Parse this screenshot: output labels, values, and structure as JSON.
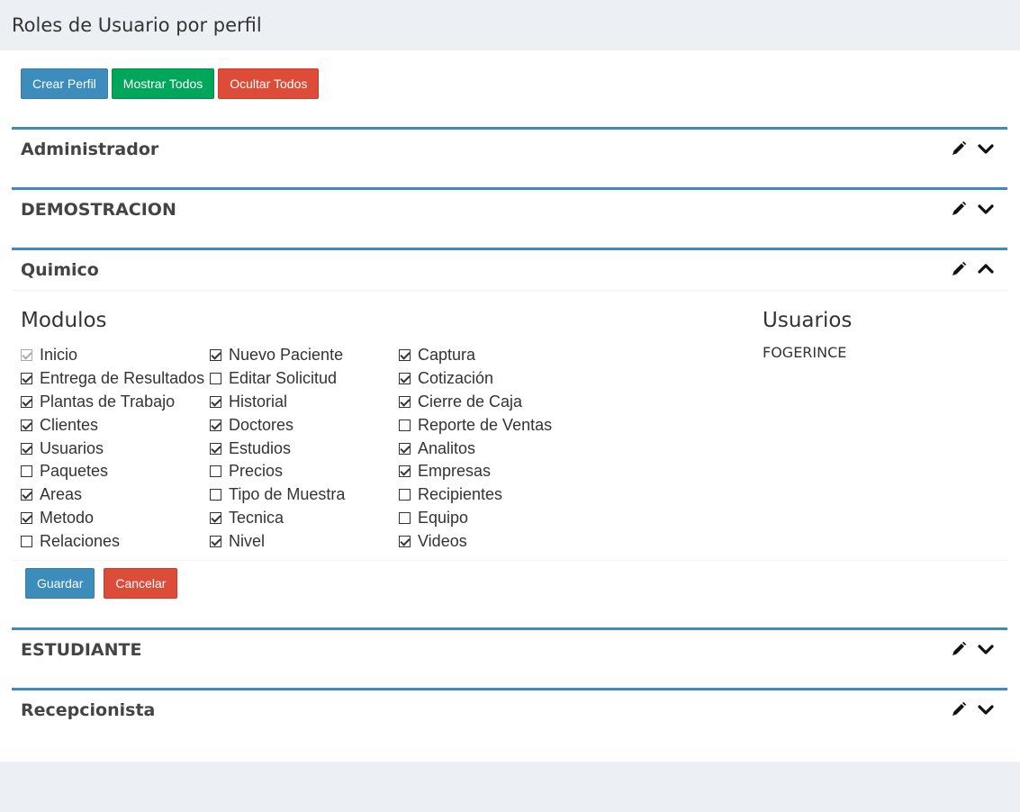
{
  "header": {
    "title": "Roles de Usuario por perfil"
  },
  "toolbar": {
    "create_label": "Crear Perfil",
    "show_all_label": "Mostrar Todos",
    "hide_all_label": "Ocultar Todos"
  },
  "colors": {
    "primary": "#3c8dbc",
    "success": "#00a65a",
    "danger": "#dd4b39",
    "background": "#ecf0f5"
  },
  "profiles": [
    {
      "name": "Administrador",
      "expanded": false
    },
    {
      "name": "DEMOSTRACION",
      "expanded": false
    },
    {
      "name": "Quimico",
      "expanded": true
    },
    {
      "name": "ESTUDIANTE",
      "expanded": false
    },
    {
      "name": "Recepcionista",
      "expanded": false
    }
  ],
  "quimico": {
    "modulos_title": "Modulos",
    "usuarios_title": "Usuarios",
    "usuarios": [
      "FOGERINCE"
    ],
    "columns": [
      [
        {
          "label": "Inicio",
          "checked": true,
          "disabled": true
        },
        {
          "label": "Entrega de Resultados",
          "checked": true
        },
        {
          "label": "Plantas de Trabajo",
          "checked": true
        },
        {
          "label": "Clientes",
          "checked": true
        },
        {
          "label": "Usuarios",
          "checked": true
        },
        {
          "label": "Paquetes",
          "checked": false
        },
        {
          "label": "Areas",
          "checked": true
        },
        {
          "label": "Metodo",
          "checked": true
        },
        {
          "label": "Relaciones",
          "checked": false
        }
      ],
      [
        {
          "label": "Nuevo Paciente",
          "checked": true
        },
        {
          "label": "Editar Solicitud",
          "checked": false
        },
        {
          "label": "Historial",
          "checked": true
        },
        {
          "label": "Doctores",
          "checked": true
        },
        {
          "label": "Estudios",
          "checked": true
        },
        {
          "label": "Precios",
          "checked": false
        },
        {
          "label": "Tipo de Muestra",
          "checked": false
        },
        {
          "label": "Tecnica",
          "checked": true
        },
        {
          "label": "Nivel",
          "checked": true
        }
      ],
      [
        {
          "label": "Captura",
          "checked": true
        },
        {
          "label": "Cotización",
          "checked": true
        },
        {
          "label": "Cierre de Caja",
          "checked": true
        },
        {
          "label": "Reporte de Ventas",
          "checked": false
        },
        {
          "label": "Analitos",
          "checked": true
        },
        {
          "label": "Empresas",
          "checked": true
        },
        {
          "label": "Recipientes",
          "checked": false
        },
        {
          "label": "Equipo",
          "checked": false
        },
        {
          "label": "Videos",
          "checked": true
        }
      ]
    ],
    "save_label": "Guardar",
    "cancel_label": "Cancelar"
  }
}
